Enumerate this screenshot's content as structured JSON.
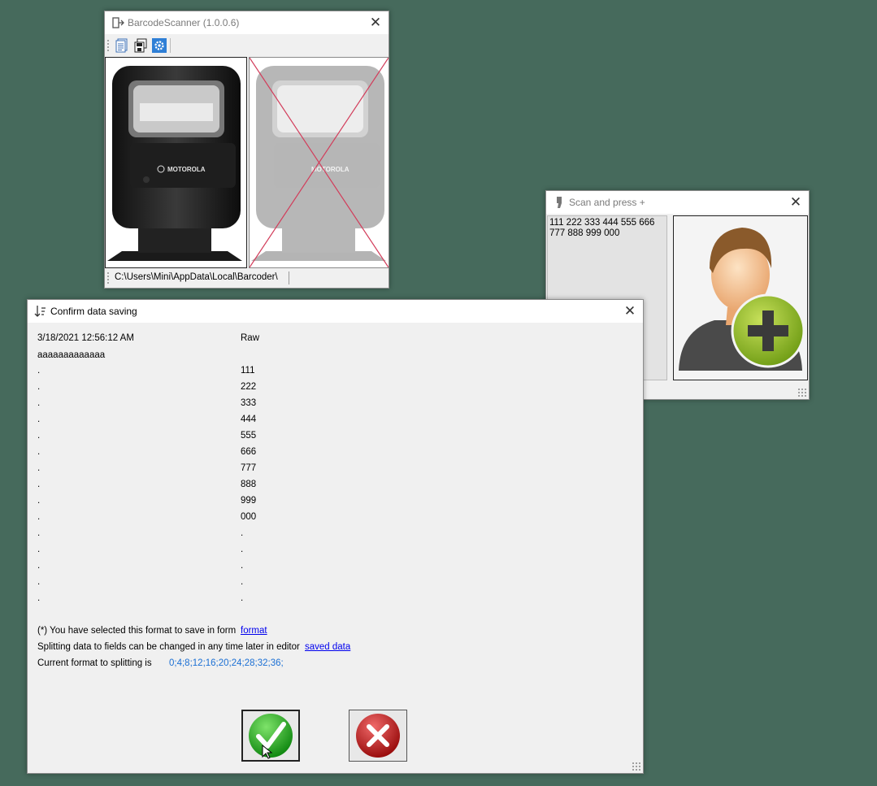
{
  "scanner_window": {
    "title": "BarcodeScanner (1.0.0.6)",
    "toolbar": {
      "icons": [
        "document-list-icon",
        "save-copy-icon",
        "settings-gear-icon"
      ]
    },
    "images": {
      "left": "motorola-scanner-image",
      "right": "motorola-scanner-disabled-image"
    },
    "brand_text": "MOTOROLA",
    "status_path": "C:\\Users\\Mini\\AppData\\Local\\Barcoder\\"
  },
  "scan_window": {
    "title": "Scan and press +",
    "scanned_text": "111 222 333 444 555 666 777 888 999 000",
    "add_button_icon": "add-user-icon"
  },
  "confirm_dialog": {
    "title": "Confirm data saving",
    "timestamp": "3/18/2021 12:56:12 AM",
    "raw_header": "Raw",
    "first_value": "aaaaaaaaaaaaa",
    "left_column": [
      ".",
      ".",
      ".",
      ".",
      ".",
      ".",
      ".",
      ".",
      ".",
      ".",
      ".",
      ".",
      ".",
      ".",
      "."
    ],
    "right_column": [
      "111",
      "222",
      "333",
      "444",
      "555",
      "666",
      "777",
      "888",
      "999",
      "000",
      ".",
      ".",
      ".",
      ".",
      "."
    ],
    "note_selected": "(*) You have selected this format to save in form",
    "link_format": "format",
    "note_splitting": "Splitting data to fields can be changed in any time later in editor",
    "link_saved": "saved data",
    "note_current": "Current format to splitting is",
    "current_format": "0;4;8;12;16;20;24;28;32;36;",
    "ok_icon": "green-checkmark-icon",
    "cancel_icon": "red-x-icon"
  },
  "colors": {
    "desktop": "#466a5c",
    "window_bg": "#f0f0f0",
    "link": "#0000ee",
    "format_text": "#1a6fd4"
  }
}
